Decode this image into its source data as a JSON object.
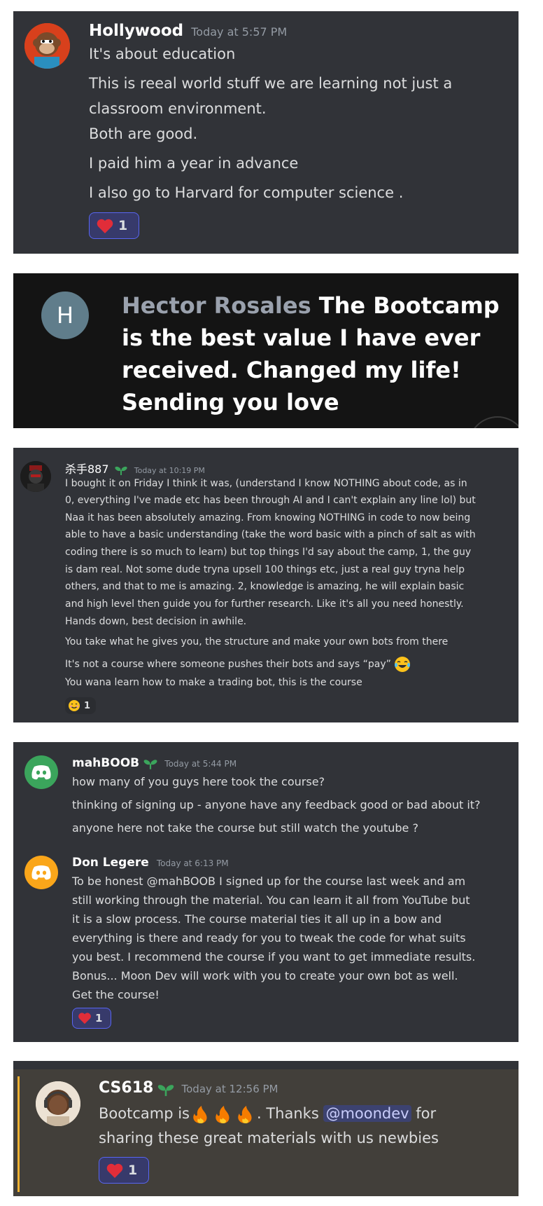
{
  "colors": {
    "discord_bg": "#313338",
    "dark_bg": "#141414",
    "mention_bg": "#3c4270",
    "accent_gold": "#f0b232",
    "discord_green": "#3ba55c",
    "discord_orange": "#faa61a",
    "heart": "#e12d39"
  },
  "card1": {
    "author": "Hollywood",
    "timestamp": "Today at 5:57 PM",
    "lines": [
      "It's about education",
      "This is reeal world stuff we are learning not just a",
      "classroom environment.",
      "Both are good.",
      "I paid him a year in advance",
      "I also go to Harvard for computer science ."
    ],
    "reaction": {
      "emoji": "heart",
      "count": "1"
    }
  },
  "card2": {
    "avatar_letter": "H",
    "author": "Hector Rosales",
    "lines": [
      "The Bootcamp",
      "is the best value I have ever",
      "received. Changed my life!",
      "Sending you love"
    ]
  },
  "card3": {
    "author": "杀手887",
    "timestamp": "Today at 10:19 PM",
    "lines": [
      "I bought it on Friday I think it was, (understand I know NOTHING about code, as in",
      "0, everything I've made etc has been through AI and I can't explain any line lol) but",
      "Naa it has been absolutely amazing. From knowing NOTHING in code to now being",
      "able to have a basic understanding (take the word basic with a pinch of salt as with",
      "coding there is so much to learn) but top things I'd say about the camp, 1, the guy",
      "is dam real. Not some dude tryna upsell 100 things etc, just a real guy tryna help",
      "others, and that to me is amazing. 2, knowledge is amazing, he will explain basic",
      "and high level then guide you for further research. Like it's all you need honestly.",
      "Hands down, best decision in awhile."
    ],
    "line2": "You take what he gives you, the structure and make your own bots from there",
    "line3": "It's not a course where someone pushes their bots and says “pay”",
    "line4": "You wana learn how to make a trading bot, this is the course",
    "reaction": {
      "emoji": "smile",
      "count": "1"
    }
  },
  "card4": {
    "msg1": {
      "author": "mahBOOB",
      "timestamp": "Today at 5:44 PM",
      "lines": [
        "how many of you guys here took the course?",
        "thinking of signing up - anyone have any feedback good or bad about it?",
        "anyone here not take the course but still watch the youtube ?"
      ]
    },
    "msg2": {
      "author": "Don Legere",
      "timestamp": "Today at 6:13 PM",
      "lines": [
        "To be honest @mahBOOB I signed up for the course last week and am",
        "still working through the material. You can learn it all from YouTube but",
        "it is a slow process. The course material ties it all up in a bow and",
        "everything is there and ready for you to tweak the code for what suits",
        "you best. I recommend the course if you want to get immediate results.",
        "Bonus... Moon Dev will work with you to create your own bot as well.",
        "Get the course!"
      ],
      "reaction": {
        "emoji": "heart",
        "count": "1"
      }
    }
  },
  "card5": {
    "author": "CS618",
    "timestamp": "Today at 12:56 PM",
    "text_before": "Bootcamp is",
    "text_after": ". Thanks ",
    "mention": "@moondev",
    "text_tail": " for",
    "line2": "sharing these great materials with us newbies",
    "reaction": {
      "emoji": "heart",
      "count": "1"
    }
  }
}
